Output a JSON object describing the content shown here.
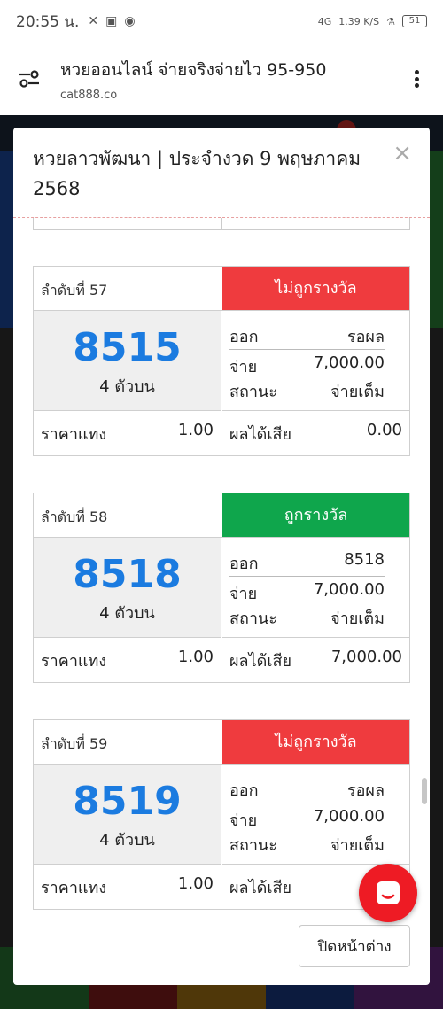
{
  "statusbar": {
    "time": "20:55 น.",
    "net": "4G",
    "speed": "1.39 K/S",
    "battery": "51"
  },
  "browser": {
    "page_title": "หวยออนไลน์ จ่ายจริงจ่ายไว 95-950",
    "url": "cat888.co"
  },
  "modal": {
    "title": "หวยลาวพัฒนา | ประจำงวด 9 พฤษภาคม 2568",
    "close_symbol": "×",
    "close_button": "ปิดหน้าต่าง"
  },
  "labels": {
    "out": "ออก",
    "pay": "จ่าย",
    "state": "สถานะ",
    "bet_price": "ราคาแทง",
    "profit_loss": "ผลได้เสีย"
  },
  "tickets": [
    {
      "seq": "ลำดับที่ 57",
      "status": "ไม่ถูกรางวัล",
      "status_color": "#ef3b3e",
      "number": "8515",
      "type": "4 ตัวบน",
      "out": "รอผล",
      "pay": "7,000.00",
      "state": "จ่ายเต็ม",
      "price": "1.00",
      "result": "0.00"
    },
    {
      "seq": "ลำดับที่ 58",
      "status": "ถูกรางวัล",
      "status_color": "#0fa64c",
      "number": "8518",
      "type": "4 ตัวบน",
      "out": "8518",
      "pay": "7,000.00",
      "state": "จ่ายเต็ม",
      "price": "1.00",
      "result": "7,000.00"
    },
    {
      "seq": "ลำดับที่ 59",
      "status": "ไม่ถูกรางวัล",
      "status_color": "#ef3b3e",
      "number": "8519",
      "type": "4 ตัวบน",
      "out": "รอผล",
      "pay": "7,000.00",
      "state": "จ่ายเต็ม",
      "price": "1.00",
      "result": ""
    }
  ]
}
